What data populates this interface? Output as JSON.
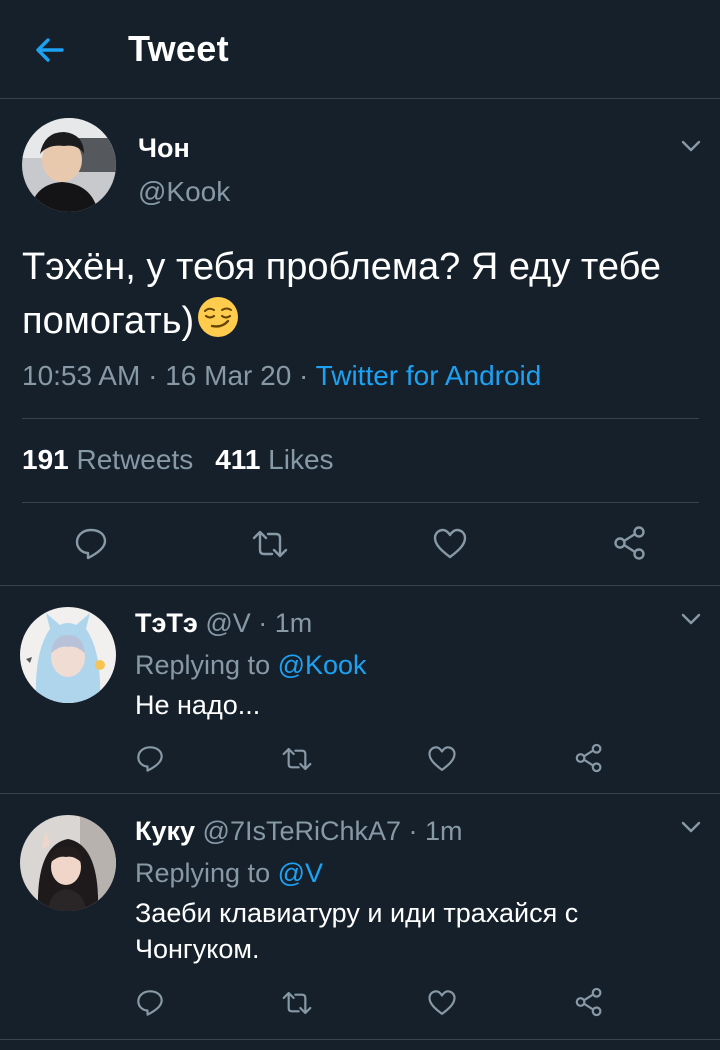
{
  "header": {
    "title": "Tweet"
  },
  "tweet": {
    "name": "Чон",
    "handle": "@Kook",
    "text": "Тэхён, у тебя проблема? Я еду тебе помогать)",
    "emoji": "smirking-face",
    "time": "10:53 AM",
    "date": "16 Mar 20",
    "source": "Twitter for Android",
    "retweets": "191",
    "retweets_label": "Retweets",
    "likes": "411",
    "likes_label": "Likes"
  },
  "replies": [
    {
      "name": "ТэТэ",
      "handle": "@V",
      "time": "1m",
      "replying_label": "Replying to",
      "replying_to": "@Kook",
      "text": "Не надо..."
    },
    {
      "name": "Куку",
      "handle": "@7IsTeRiChkA7",
      "time": "1m",
      "replying_label": "Replying to",
      "replying_to": "@V",
      "text": "Заеби клавиатуру и иди трахайся с Чонгуком."
    }
  ],
  "colors": {
    "background": "#15202b",
    "accent": "#1da1f2",
    "secondary": "#8899a6",
    "divider": "#38444d"
  },
  "icons": [
    "back-arrow-icon",
    "chevron-down-icon",
    "reply-icon",
    "retweet-icon",
    "like-icon",
    "share-icon"
  ]
}
